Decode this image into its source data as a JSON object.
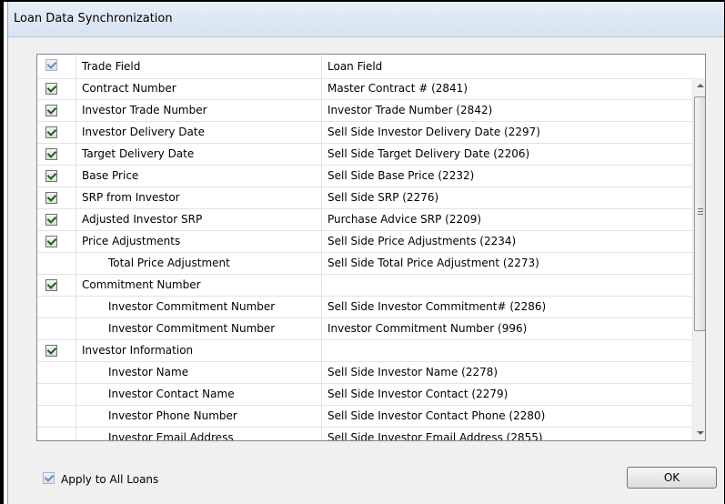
{
  "window": {
    "title": "Loan Data Synchronization"
  },
  "grid": {
    "header": {
      "select_all_checked": true,
      "trade_field": "Trade Field",
      "loan_field": "Loan Field"
    },
    "rows": [
      {
        "checkbox": true,
        "checked": true,
        "indent": false,
        "trade": "Contract Number",
        "loan": "Master Contract # (2841)"
      },
      {
        "checkbox": true,
        "checked": true,
        "indent": false,
        "trade": "Investor Trade Number",
        "loan": "Investor Trade Number (2842)"
      },
      {
        "checkbox": true,
        "checked": true,
        "indent": false,
        "trade": "Investor Delivery Date",
        "loan": "Sell Side Investor Delivery Date (2297)"
      },
      {
        "checkbox": true,
        "checked": true,
        "indent": false,
        "trade": "Target Delivery Date",
        "loan": "Sell Side Target Delivery Date (2206)"
      },
      {
        "checkbox": true,
        "checked": true,
        "indent": false,
        "trade": "Base Price",
        "loan": "Sell Side Base Price (2232)"
      },
      {
        "checkbox": true,
        "checked": true,
        "indent": false,
        "trade": "SRP from Investor",
        "loan": "Sell Side SRP  (2276)"
      },
      {
        "checkbox": true,
        "checked": true,
        "indent": false,
        "trade": "Adjusted Investor SRP",
        "loan": "Purchase Advice SRP (2209)"
      },
      {
        "checkbox": true,
        "checked": true,
        "indent": false,
        "trade": "Price Adjustments",
        "loan": "Sell Side Price Adjustments (2234)"
      },
      {
        "checkbox": false,
        "checked": false,
        "indent": true,
        "trade": "Total Price Adjustment",
        "loan": "Sell Side Total Price Adjustment (2273)"
      },
      {
        "checkbox": true,
        "checked": true,
        "indent": false,
        "trade": "Commitment Number",
        "loan": ""
      },
      {
        "checkbox": false,
        "checked": false,
        "indent": true,
        "trade": "Investor Commitment Number",
        "loan": "Sell Side Investor Commitment# (2286)"
      },
      {
        "checkbox": false,
        "checked": false,
        "indent": true,
        "trade": "Investor Commitment Number",
        "loan": "Investor Commitment Number (996)"
      },
      {
        "checkbox": true,
        "checked": true,
        "indent": false,
        "trade": "Investor Information",
        "loan": ""
      },
      {
        "checkbox": false,
        "checked": false,
        "indent": true,
        "trade": "Investor Name",
        "loan": "Sell Side Investor Name (2278)"
      },
      {
        "checkbox": false,
        "checked": false,
        "indent": true,
        "trade": "Investor Contact Name",
        "loan": "Sell Side Investor Contact (2279)"
      },
      {
        "checkbox": false,
        "checked": false,
        "indent": true,
        "trade": "Investor Phone Number",
        "loan": "Sell Side Investor Contact Phone (2280)"
      },
      {
        "checkbox": false,
        "checked": false,
        "indent": true,
        "trade": "Investor Email Address",
        "loan": "Sell Side Investor Email Address (2855)"
      }
    ]
  },
  "footer": {
    "apply_all_checked": true,
    "apply_all_label": "Apply to All Loans",
    "ok_label": "OK"
  },
  "icons": {
    "checkbox": "checkmark-icon",
    "scroll_up": "chevron-up-icon",
    "scroll_down": "chevron-down-icon"
  }
}
